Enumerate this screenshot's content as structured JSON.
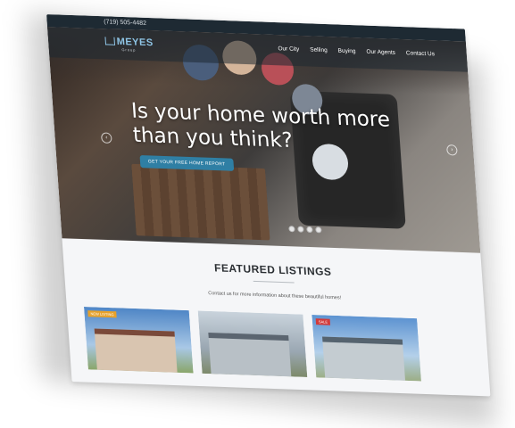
{
  "topbar": {
    "phone": "(719) 505-4482"
  },
  "nav": {
    "logo_text": "MEYES",
    "logo_sub": "Group",
    "items": [
      "Our City",
      "Selling",
      "Buying",
      "Our Agents",
      "Contact Us"
    ]
  },
  "hero": {
    "headline_line1": "Is your home worth more",
    "headline_line2": "than you think?",
    "cta_label": "GET YOUR FREE HOME REPORT",
    "slide_count": 4
  },
  "featured": {
    "title": "FEATURED LISTINGS",
    "subtitle": "Contact us for more information about these beautiful homes!"
  },
  "listings": [
    {
      "badge": "NEW LISTING",
      "badge_color": "#e7a12a"
    },
    {
      "badge": "",
      "badge_color": ""
    },
    {
      "badge": "SALE",
      "badge_color": "#d23b3b"
    }
  ],
  "colors": {
    "accent": "#2f7fa4",
    "topbar": "#1e2a33"
  }
}
